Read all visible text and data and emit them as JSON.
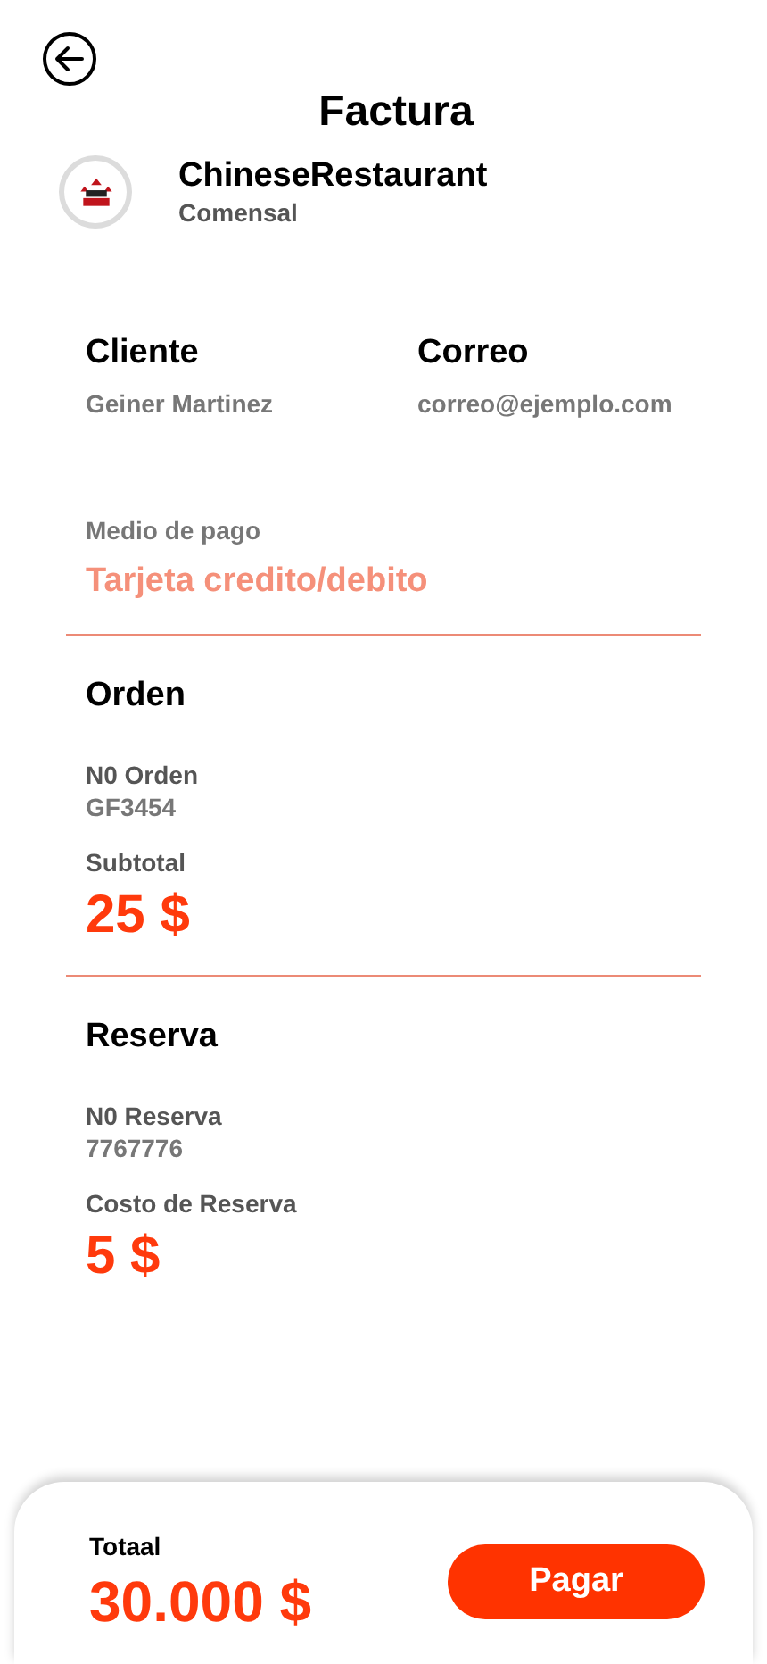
{
  "header": {
    "title": "Factura"
  },
  "restaurant": {
    "name": "ChineseRestaurant",
    "role": "Comensal"
  },
  "client": {
    "label": "Cliente",
    "value": "Geiner Martinez"
  },
  "email": {
    "label": "Correo",
    "value": "correo@ejemplo.com"
  },
  "payment": {
    "label": "Medio de pago",
    "value": "Tarjeta credito/debito"
  },
  "sections": [
    {
      "title": "Orden",
      "number_label": "N0 Orden",
      "number": "GF3454",
      "amount_label": "Subtotal",
      "amount": "25 $"
    },
    {
      "title": "Reserva",
      "number_label": "N0 Reserva",
      "number": "7767776",
      "amount_label": "Costo de Reserva",
      "amount": "5 $"
    }
  ],
  "footer": {
    "total_label": "Totaal",
    "total": "30.000 $",
    "button": "Pagar"
  }
}
